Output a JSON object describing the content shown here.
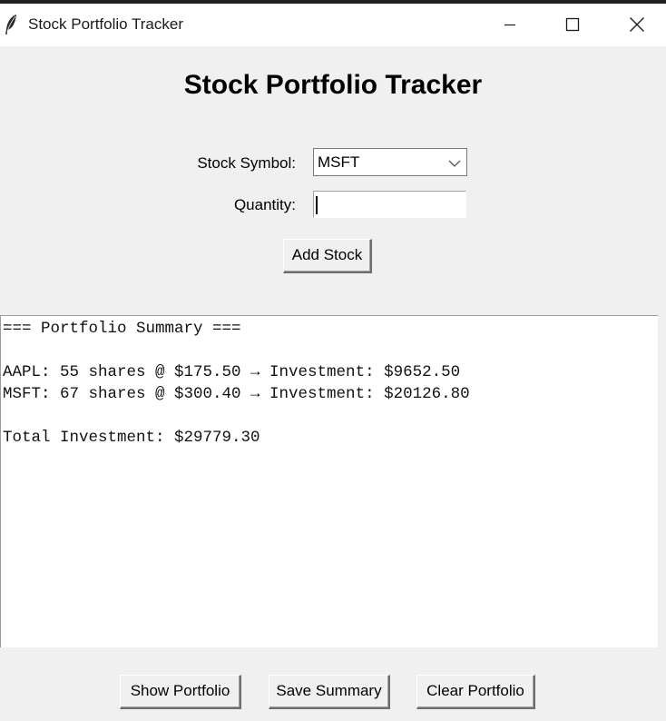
{
  "window": {
    "title": "Stock Portfolio Tracker",
    "icon": "feather-icon",
    "controls": [
      "minimize-icon",
      "maximize-icon",
      "close-icon"
    ]
  },
  "heading": "Stock Portfolio Tracker",
  "form": {
    "symbol_label": "Stock Symbol:",
    "symbol_value": "MSFT",
    "quantity_label": "Quantity:",
    "quantity_value": "",
    "add_button": "Add Stock"
  },
  "output": {
    "lines": [
      "=== Portfolio Summary ===",
      "",
      "AAPL: 55 shares @ $175.50 → Investment: $9652.50",
      "MSFT: 67 shares @ $300.40 → Investment: $20126.80",
      "",
      "Total Investment: $29779.30"
    ]
  },
  "actions": {
    "show": "Show Portfolio",
    "save": "Save Summary",
    "clear": "Clear Portfolio"
  },
  "colors": {
    "window_bg": "#f0f0f0",
    "titlebar_bg": "#ffffff",
    "text": "#000000"
  }
}
